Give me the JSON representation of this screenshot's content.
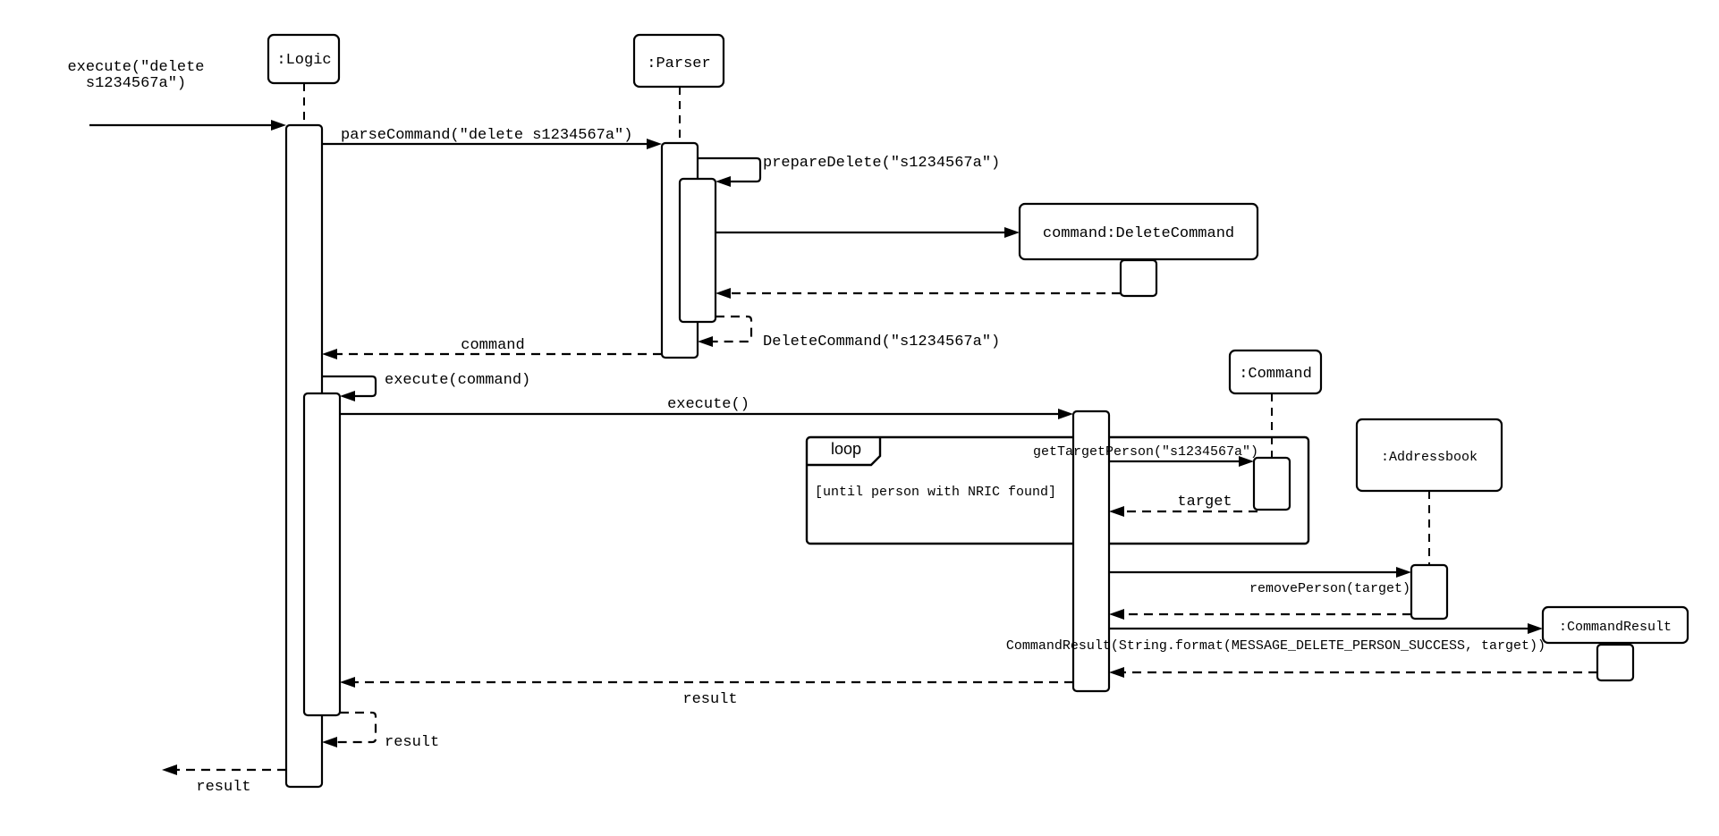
{
  "diagram": {
    "type": "uml-sequence",
    "participants": {
      "logic": ":Logic",
      "parser": ":Parser",
      "delete_command": "command:DeleteCommand",
      "command": ":Command",
      "addressbook": ":Addressbook",
      "command_result": ":CommandResult"
    },
    "messages": {
      "entry_line1": "execute(\"delete",
      "entry_line2": "s1234567a\")",
      "parse_command": "parseCommand(\"delete s1234567a\")",
      "prepare_delete": "prepareDelete(\"s1234567a\")",
      "delete_command_ctor": "DeleteCommand(\"s1234567a\")",
      "return_command": "command",
      "execute_command": "execute(command)",
      "execute": "execute()",
      "get_target_person": "getTargetPerson(\"s1234567a\")",
      "return_target": "target",
      "remove_person": "removePerson(target)",
      "command_result_ctor": "CommandResult(String.format(MESSAGE_DELETE_PERSON_SUCCESS, target))",
      "return_result_execute": "result",
      "return_result_self": "result",
      "return_result_final": "result"
    },
    "fragments": {
      "loop_label": "loop",
      "loop_guard": "[until person with NRIC found]"
    }
  }
}
